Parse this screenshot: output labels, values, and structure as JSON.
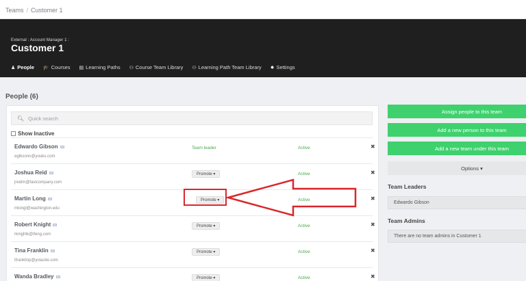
{
  "breadcrumb": {
    "items": [
      "Teams",
      "Customer 1"
    ],
    "separator": "/"
  },
  "header": {
    "subtitle": "External : Account Manager 1 :",
    "title": "Customer 1",
    "nav": [
      {
        "label": "People",
        "icon": "person-icon",
        "glyph": "♟"
      },
      {
        "label": "Courses",
        "icon": "graduation-cap-icon",
        "glyph": "🎓"
      },
      {
        "label": "Learning Paths",
        "icon": "book-icon",
        "glyph": "▤"
      },
      {
        "label": "Course Team Library",
        "icon": "users-icon",
        "glyph": "⚇"
      },
      {
        "label": "Learning Path Team Library",
        "icon": "users-icon",
        "glyph": "⚇"
      },
      {
        "label": "Settings",
        "icon": "gear-icon",
        "glyph": "✸"
      }
    ]
  },
  "people": {
    "heading": "People (6)",
    "search_placeholder": "Quick search",
    "show_inactive_label": "Show Inactive",
    "promote_label": "Promote ▾",
    "remove_glyph": "✖",
    "rows": [
      {
        "name": "Edwardo Gibson",
        "email": "egibsonn@youku.com",
        "role": "Team leader",
        "status": "Active"
      },
      {
        "name": "Joshua Reid",
        "email": "jreidm@fastcompany.com",
        "role": "",
        "status": "Active"
      },
      {
        "name": "Martin Long",
        "email": "mlongl@washington.edu",
        "role": "",
        "status": "Active"
      },
      {
        "name": "Robert Knight",
        "email": "rknightk@ifeng.com",
        "role": "",
        "status": "Active"
      },
      {
        "name": "Tina Franklin",
        "email": "tfranklinp@yolasite.com",
        "role": "",
        "status": "Active"
      },
      {
        "name": "Wanda Bradley",
        "email": "",
        "role": "",
        "status": "Active"
      }
    ]
  },
  "sidebar": {
    "assign_label": "Assign people to this team",
    "add_person_label": "Add a new person to this team",
    "add_team_label": "Add a new team under this team",
    "options_label": "Options ▾",
    "leaders_title": "Team Leaders",
    "leader_name": "Edwardo Gibson",
    "admins_title": "Team Admins",
    "admins_empty": "There are no team admins in Customer 1"
  },
  "colors": {
    "accent_green": "#3ed16d",
    "header_dark": "#1f1f1f",
    "highlight_red": "#d9262a"
  }
}
